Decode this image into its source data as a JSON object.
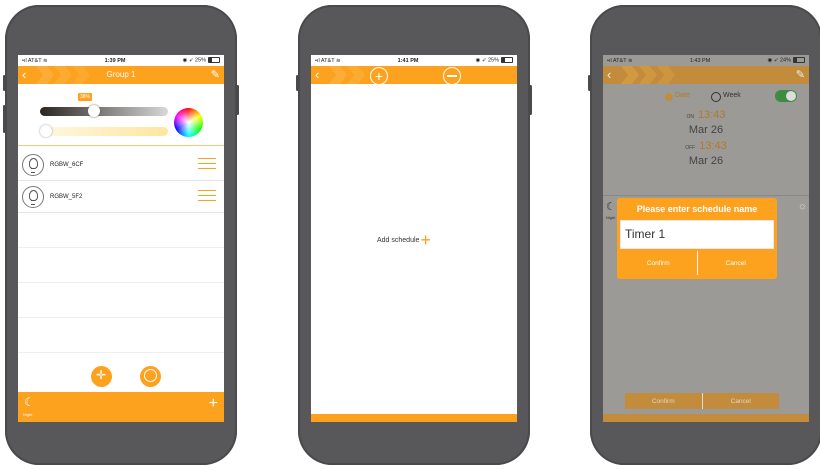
{
  "phone1": {
    "status": {
      "carrier": "AT&T",
      "time": "1:39 PM",
      "battery": "25%"
    },
    "title": "Group 1",
    "brightness_badge": "38%",
    "lights": [
      {
        "name": "RGBW_6CF"
      },
      {
        "name": "RGBW_5F2"
      }
    ],
    "bottom_label": "Night"
  },
  "phone2": {
    "status": {
      "carrier": "AT&T",
      "time": "1:41 PM",
      "battery": "25%"
    },
    "add_schedule": "Add schedule"
  },
  "phone3": {
    "status": {
      "carrier": "AT&T",
      "time": "1:43 PM",
      "battery": "24%"
    },
    "date_label": "Date",
    "week_label": "Week",
    "on_label": "ON",
    "on_time": "13:43",
    "on_date": "Mar 26",
    "off_label": "OFF",
    "off_time": "13:43",
    "off_date": "Mar 26",
    "night_label": "Night",
    "dialog": {
      "title": "Please enter schedule name",
      "value": "Timer 1",
      "confirm": "Confirm",
      "cancel": "Cancel"
    },
    "bottom_confirm": "Confirm",
    "bottom_cancel": "Cancel"
  },
  "colors": {
    "accent": "#fca21f",
    "phone_body": "#58585a"
  }
}
